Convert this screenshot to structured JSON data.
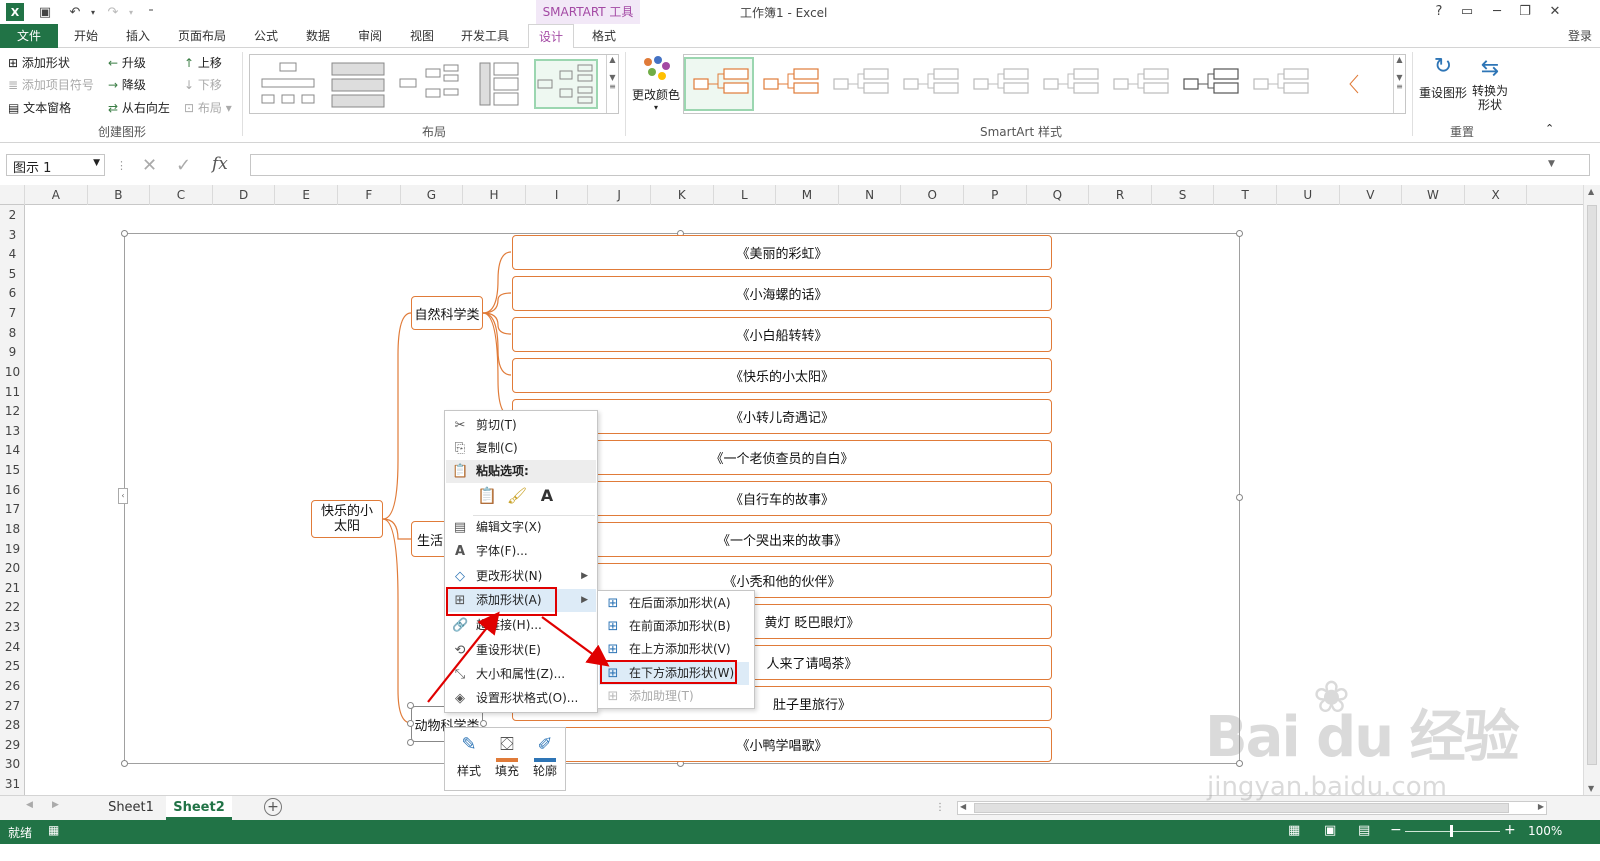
{
  "window": {
    "title": "工作簿1 - Excel",
    "contextual_tools": "SMARTART 工具",
    "help": "?",
    "login": "登录"
  },
  "tabs": [
    "文件",
    "开始",
    "插入",
    "页面布局",
    "公式",
    "数据",
    "审阅",
    "视图",
    "开发工具",
    "设计",
    "格式"
  ],
  "ribbon": {
    "create_graphic": {
      "items": [
        "添加形状",
        "添加项目符号",
        "文本窗格",
        "升级",
        "降级",
        "从右向左",
        "上移",
        "下移",
        "布局"
      ],
      "label": "创建图形"
    },
    "layouts_label": "布局",
    "change_colors": "更改颜色",
    "styles_label": "SmartArt 样式",
    "reset": {
      "reset_graphic": "重设图形",
      "convert1": "转换为",
      "convert2": "形状",
      "label": "重置"
    }
  },
  "formula_bar": {
    "name_box": "图示 1",
    "fx": "fx",
    "value": ""
  },
  "columns": [
    "A",
    "B",
    "C",
    "D",
    "E",
    "F",
    "G",
    "H",
    "I",
    "J",
    "K",
    "L",
    "M",
    "N",
    "O",
    "P",
    "Q",
    "R",
    "S",
    "T",
    "U",
    "V",
    "W",
    "X"
  ],
  "rows": [
    "2",
    "3",
    "4",
    "5",
    "6",
    "7",
    "8",
    "9",
    "10",
    "11",
    "12",
    "13",
    "14",
    "15",
    "16",
    "17",
    "18",
    "19",
    "20",
    "21",
    "22",
    "23",
    "24",
    "25",
    "26",
    "27",
    "28",
    "29",
    "30",
    "31"
  ],
  "smartart": {
    "root": "快乐的小太阳",
    "level1": [
      "自然科学类",
      "生活",
      "动物科学类"
    ],
    "leaves": [
      "《美丽的彩虹》",
      "《小海螺的话》",
      "《小白船转转》",
      "《快乐的小太阳》",
      "《小转儿奇遇记》",
      "《一个老侦查员的自白》",
      "《自行车的故事》",
      "《一个哭出来的故事》",
      "《小秃和他的伙伴》",
      "黄灯 眨巴眼灯》",
      "人来了请喝茶》",
      "肚子里旅行》",
      "《小鸭学唱歌》"
    ]
  },
  "context_menu": {
    "cut": "剪切(T)",
    "copy": "复制(C)",
    "paste_header": "粘贴选项:",
    "edit_text": "编辑文字(X)",
    "font": "字体(F)...",
    "change_shape": "更改形状(N)",
    "add_shape": "添加形状(A)",
    "hyperlink": "超链接(H)...",
    "reset_shape": "重设形状(E)",
    "size_props": "大小和属性(Z)...",
    "format_shape": "设置形状格式(O)..."
  },
  "submenu": {
    "after": "在后面添加形状(A)",
    "before": "在前面添加形状(B)",
    "above": "在上方添加形状(V)",
    "below": "在下方添加形状(W)",
    "assistant": "添加助理(T)"
  },
  "mini_toolbar": [
    "样式",
    "填充",
    "轮廓"
  ],
  "sheets": [
    "Sheet1",
    "Sheet2"
  ],
  "status": {
    "ready": "就绪",
    "zoom": "100%"
  },
  "watermark": {
    "brand": "Bai du 经验",
    "url": "jingyan.baidu.com"
  },
  "colors": {
    "excel_green": "#217346",
    "smartart_orange": "#e07b39",
    "design_purple": "#a349a4",
    "highlight_red": "#e00000"
  }
}
